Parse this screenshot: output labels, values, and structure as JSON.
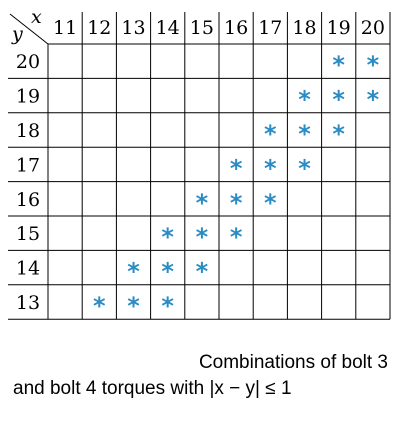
{
  "corner": {
    "x_var": "x",
    "y_var": "y"
  },
  "columns": [
    "11",
    "12",
    "13",
    "14",
    "15",
    "16",
    "17",
    "18",
    "19",
    "20"
  ],
  "rows": [
    "20",
    "19",
    "18",
    "17",
    "16",
    "15",
    "14",
    "13"
  ],
  "marked_symbol": "*",
  "marked_color": "#2b8cc4",
  "marked_cells": [
    {
      "x": 19,
      "y": 20
    },
    {
      "x": 20,
      "y": 20
    },
    {
      "x": 18,
      "y": 19
    },
    {
      "x": 19,
      "y": 19
    },
    {
      "x": 20,
      "y": 19
    },
    {
      "x": 17,
      "y": 18
    },
    {
      "x": 18,
      "y": 18
    },
    {
      "x": 19,
      "y": 18
    },
    {
      "x": 16,
      "y": 17
    },
    {
      "x": 17,
      "y": 17
    },
    {
      "x": 18,
      "y": 17
    },
    {
      "x": 15,
      "y": 16
    },
    {
      "x": 16,
      "y": 16
    },
    {
      "x": 17,
      "y": 16
    },
    {
      "x": 14,
      "y": 15
    },
    {
      "x": 15,
      "y": 15
    },
    {
      "x": 16,
      "y": 15
    },
    {
      "x": 13,
      "y": 14
    },
    {
      "x": 14,
      "y": 14
    },
    {
      "x": 15,
      "y": 14
    },
    {
      "x": 12,
      "y": 13
    },
    {
      "x": 13,
      "y": 13
    },
    {
      "x": 14,
      "y": 13
    }
  ],
  "caption": {
    "line1": "Combinations of bolt 3",
    "line2": "and bolt 4 torques with |x − y| ≤ 1"
  }
}
